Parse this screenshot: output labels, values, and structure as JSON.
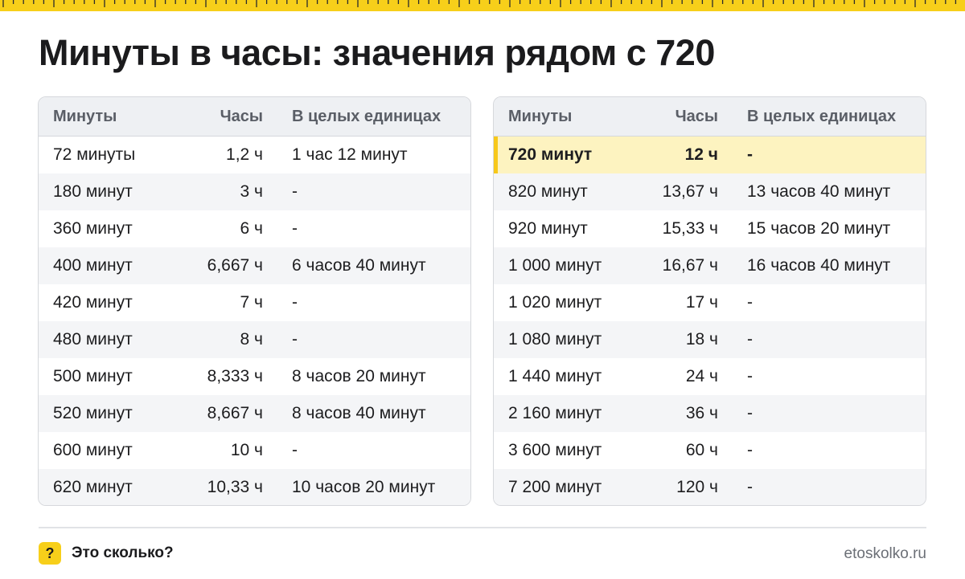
{
  "title": "Минуты в часы: значения рядом с 720",
  "columns": {
    "minutes": "Минуты",
    "hours": "Часы",
    "whole": "В целых единицах"
  },
  "left_table": [
    {
      "minutes": "72 минуты",
      "hours": "1,2 ч",
      "whole": "1 час 12 минут"
    },
    {
      "minutes": "180 минут",
      "hours": "3 ч",
      "whole": "-"
    },
    {
      "minutes": "360 минут",
      "hours": "6 ч",
      "whole": "-"
    },
    {
      "minutes": "400 минут",
      "hours": "6,667 ч",
      "whole": "6 часов 40 минут"
    },
    {
      "minutes": "420 минут",
      "hours": "7 ч",
      "whole": "-"
    },
    {
      "minutes": "480 минут",
      "hours": "8 ч",
      "whole": "-"
    },
    {
      "minutes": "500 минут",
      "hours": "8,333 ч",
      "whole": "8 часов 20 минут"
    },
    {
      "minutes": "520 минут",
      "hours": "8,667 ч",
      "whole": "8 часов 40 минут"
    },
    {
      "minutes": "600 минут",
      "hours": "10 ч",
      "whole": "-"
    },
    {
      "minutes": "620 минут",
      "hours": "10,33 ч",
      "whole": "10 часов 20 минут"
    }
  ],
  "right_table": [
    {
      "minutes": "720 минут",
      "hours": "12 ч",
      "whole": "-",
      "highlighted": true
    },
    {
      "minutes": "820 минут",
      "hours": "13,67 ч",
      "whole": "13 часов 40 минут"
    },
    {
      "minutes": "920 минут",
      "hours": "15,33 ч",
      "whole": "15 часов 20 минут"
    },
    {
      "minutes": "1 000 минут",
      "hours": "16,67 ч",
      "whole": "16 часов 40 минут"
    },
    {
      "minutes": "1 020 минут",
      "hours": "17 ч",
      "whole": "-"
    },
    {
      "minutes": "1 080 минут",
      "hours": "18 ч",
      "whole": "-"
    },
    {
      "minutes": "1 440 минут",
      "hours": "24 ч",
      "whole": "-"
    },
    {
      "minutes": "2 160 минут",
      "hours": "36 ч",
      "whole": "-"
    },
    {
      "minutes": "3 600 минут",
      "hours": "60 ч",
      "whole": "-"
    },
    {
      "minutes": "7 200 минут",
      "hours": "120 ч",
      "whole": "-"
    }
  ],
  "footer": {
    "logo_glyph": "?",
    "brand": "Это сколько?",
    "url": "etoskolko.ru"
  },
  "colors": {
    "accent": "#f7cf1a",
    "highlight_row": "#fdf3c0"
  }
}
